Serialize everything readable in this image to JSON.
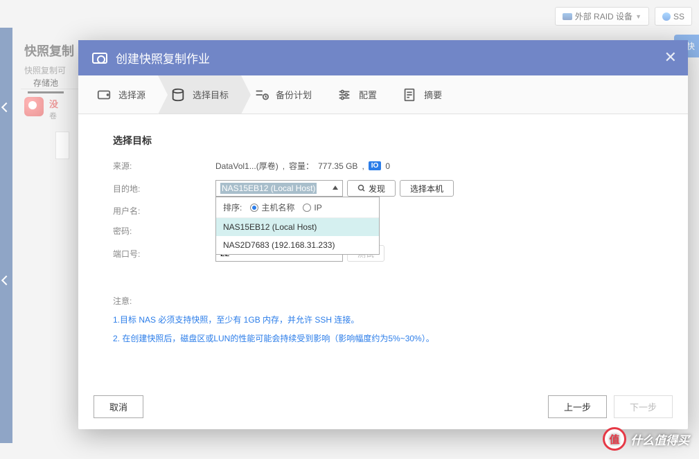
{
  "background": {
    "raid_button": "外部 RAID 设备",
    "ssh_button": "SS",
    "main_title": "快照复制",
    "subtitle": "快照复制可",
    "tab_active": "存储池",
    "alert_line1": "没",
    "alert_line2": "卷",
    "right_btn": "建快"
  },
  "modal": {
    "title": "创建快照复制作业",
    "steps": {
      "source": "选择源",
      "target": "选择目标",
      "schedule": "备份计划",
      "config": "配置",
      "summary": "摘要"
    },
    "section_title": "选择目标",
    "labels": {
      "source": "来源:",
      "destination": "目的地:",
      "username": "用户名:",
      "password": "密码:",
      "port": "端口号:"
    },
    "source_value": {
      "volume": "DataVol1...(厚卷)",
      "capacity_label": "容量：",
      "capacity": "777.35 GB",
      "io_badge": "IO",
      "io_count": "0"
    },
    "dropdown": {
      "selected": "NAS15EB12 (Local Host)",
      "sort_label": "排序:",
      "sort_opt1": "主机名称",
      "sort_opt2": "IP",
      "items": [
        "NAS15EB12 (Local Host)",
        "NAS2D7683 (192.168.31.233)"
      ]
    },
    "buttons": {
      "discover": "发现",
      "select_local": "选择本机",
      "test": "测试"
    },
    "port_value": "22",
    "notes": {
      "title": "注意:",
      "line1": "1.目标 NAS 必须支持快照，至少有 1GB 内存，并允许 SSH 连接。",
      "line2": "2. 在创建快照后，磁盘区或LUN的性能可能会持续受到影响（影响幅度约为5%~30%）。"
    },
    "footer": {
      "cancel": "取消",
      "prev": "上一步",
      "next": "下一步"
    }
  },
  "watermark": {
    "badge": "值",
    "text": "什么值得买"
  }
}
